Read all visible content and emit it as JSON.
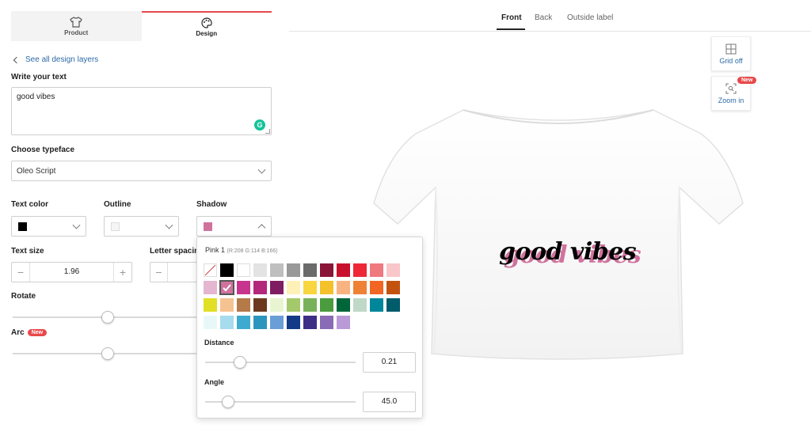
{
  "tabs": {
    "product_label": "Product",
    "design_label": "Design"
  },
  "nav": {
    "back_label": "See all design layers"
  },
  "text_section": {
    "heading": "Write your text",
    "value": "good vibes"
  },
  "typeface": {
    "heading": "Choose typeface",
    "value": "Oleo Script"
  },
  "colors": {
    "text_color_label": "Text color",
    "text_color": "#000000",
    "outline_label": "Outline",
    "outline_color": "#f5f5f5",
    "shadow_label": "Shadow",
    "shadow_color": "#d0729e"
  },
  "text_size": {
    "label": "Text size",
    "value": "1.96",
    "minus": "−",
    "plus": "+"
  },
  "letter_spacing": {
    "label": "Letter spacing",
    "minus": "−"
  },
  "rotate": {
    "label": "Rotate",
    "value_fraction": 0.5
  },
  "arc": {
    "label": "Arc",
    "badge": "New",
    "value_fraction": 0.5
  },
  "popup": {
    "color_name": "Pink 1",
    "color_rgb": "(R:208 G:114 B:166)",
    "selected_index": 13,
    "palette": [
      "transparent",
      "#000000",
      "#ffffff",
      "#e3e3e3",
      "#bfbfbf",
      "#999999",
      "#6b6b6b",
      "#8a1538",
      "#c8102e",
      "#ee2737",
      "#f0787f",
      "#f9c6c9",
      "#e4b6cf",
      "#d0729e",
      "#c8358e",
      "#b4287c",
      "#7e1d61",
      "#fdf1b8",
      "#f7d640",
      "#f4c12b",
      "#f9b380",
      "#ef8134",
      "#f26522",
      "#c4520f",
      "#e1df26",
      "#f5c391",
      "#b47a4a",
      "#6b3a1e",
      "#e9f5d1",
      "#a4c96b",
      "#78b15a",
      "#4b9b3f",
      "#00663a",
      "#bfd8c8",
      "#00869a",
      "#005b6b",
      "#e8f8f9",
      "#a6dcee",
      "#3eaad0",
      "#2c95bd",
      "#6a9ed6",
      "#123a86",
      "#3d2f86",
      "#8a6bb5",
      "#b99ad6"
    ],
    "distance_label": "Distance",
    "distance_value": "0.21",
    "distance_fraction": 0.23,
    "angle_label": "Angle",
    "angle_value": "45.0",
    "angle_fraction": 0.15
  },
  "view": {
    "front": "Front",
    "back": "Back",
    "outside_label": "Outside label"
  },
  "tools": {
    "grid_label": "Grid off",
    "zoom_label": "Zoom in",
    "zoom_badge": "New"
  },
  "design": {
    "text": "good vibes",
    "fill_color": "#000000",
    "shadow_color": "#d0729e"
  }
}
